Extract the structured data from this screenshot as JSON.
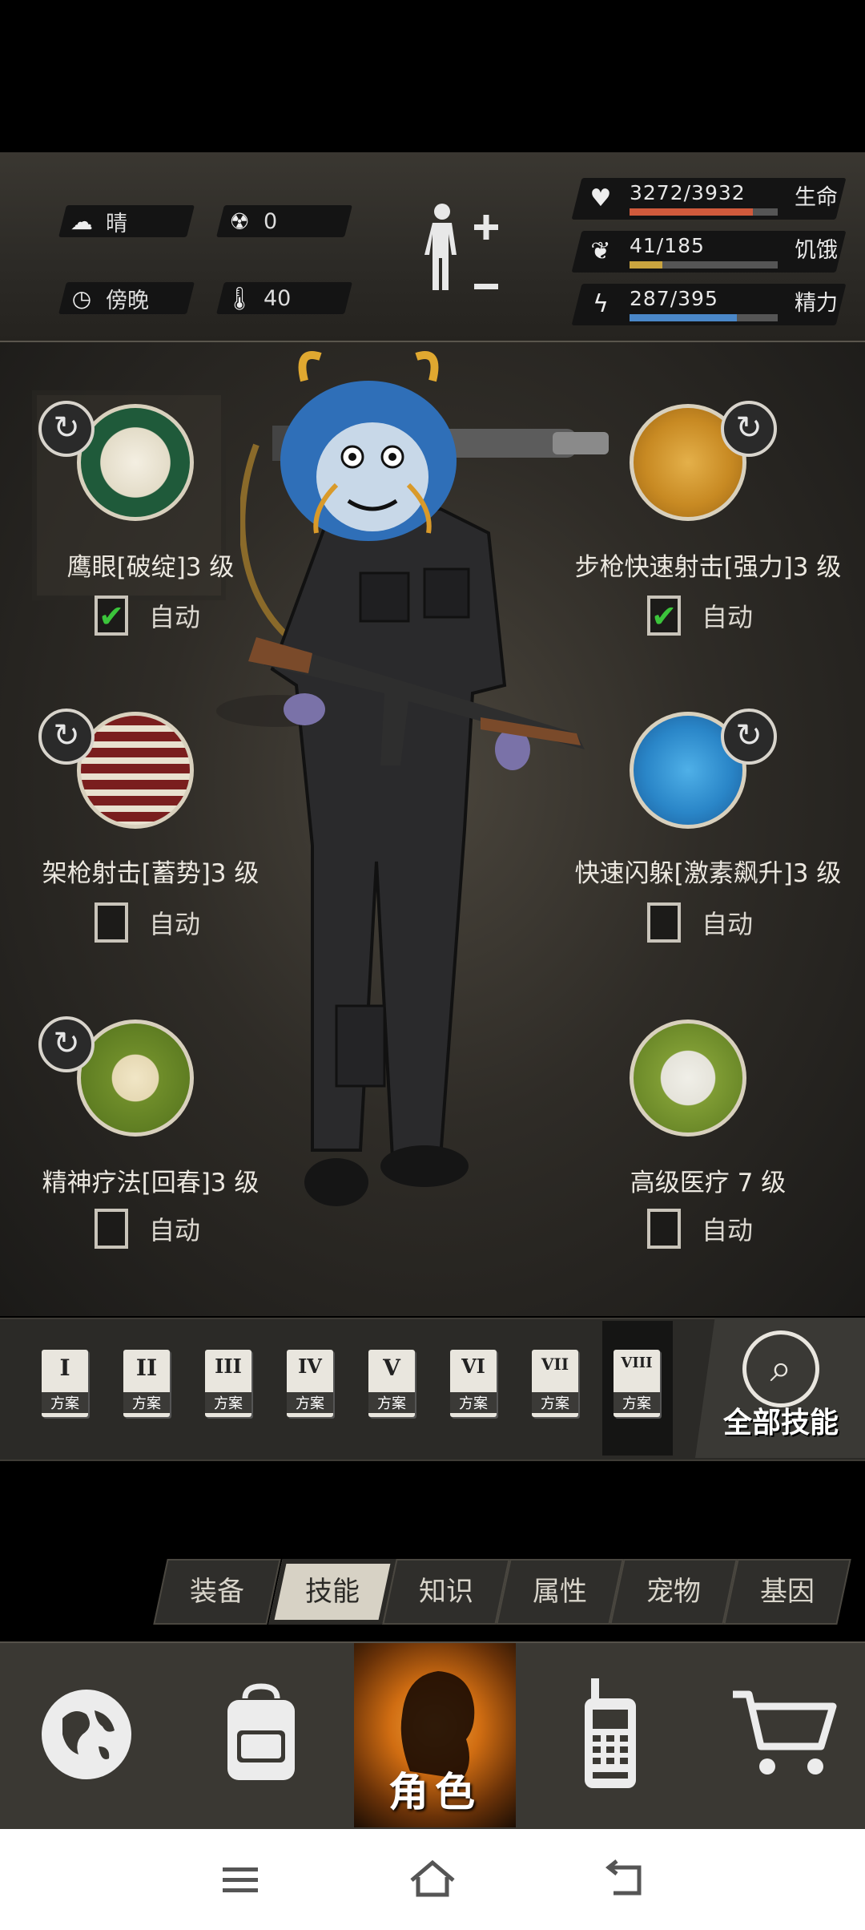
{
  "status": {
    "weather": {
      "icon": "cloud-sun-icon",
      "label": "晴"
    },
    "radiation": {
      "icon": "radiation-icon",
      "value": "0"
    },
    "time": {
      "icon": "clock-icon",
      "label": "傍晚"
    },
    "temperature": {
      "icon": "thermometer-icon",
      "value": "40"
    },
    "health": {
      "value": "3272/3932",
      "label": "生命",
      "fraction": 0.832,
      "color": "#d05a3c"
    },
    "hunger": {
      "value": "41/185",
      "label": "饥饿",
      "fraction": 0.222,
      "color": "#c9a43f"
    },
    "energy": {
      "value": "287/395",
      "label": "精力",
      "fraction": 0.727,
      "color": "#4a87c8"
    }
  },
  "skills": [
    {
      "name": "鹰眼[破绽]3 级",
      "auto_label": "自动",
      "auto": true,
      "icon": "eagle-icon"
    },
    {
      "name": "步枪快速射击[强力]3 级",
      "auto_label": "自动",
      "auto": true,
      "icon": "bullets-icon"
    },
    {
      "name": "架枪射击[蓄势]3 级",
      "auto_label": "自动",
      "auto": false,
      "icon": "prone-shooter-icon"
    },
    {
      "name": "快速闪躲[激素飙升]3 级",
      "auto_label": "自动",
      "auto": false,
      "icon": "dodge-icon"
    },
    {
      "name": "精神疗法[回春]3 级",
      "auto_label": "自动",
      "auto": false,
      "icon": "spirit-heal-icon"
    },
    {
      "name": "高级医疗 7 级",
      "auto_label": "自动",
      "auto": false,
      "icon": "medkit-icon"
    }
  ],
  "plans": [
    {
      "num": "I",
      "label": "方案"
    },
    {
      "num": "II",
      "label": "方案"
    },
    {
      "num": "III",
      "label": "方案"
    },
    {
      "num": "IV",
      "label": "方案"
    },
    {
      "num": "V",
      "label": "方案"
    },
    {
      "num": "VI",
      "label": "方案"
    },
    {
      "num": "VII",
      "label": "方案"
    },
    {
      "num": "VIII",
      "label": "方案"
    }
  ],
  "all_skills_label": "全部技能",
  "tabs": [
    {
      "label": "装备",
      "active": false
    },
    {
      "label": "技能",
      "active": true
    },
    {
      "label": "知识",
      "active": false
    },
    {
      "label": "属性",
      "active": false
    },
    {
      "label": "宠物",
      "active": false
    },
    {
      "label": "基因",
      "active": false
    }
  ],
  "nav": {
    "world": "globe-icon",
    "bag": "backpack-icon",
    "character": {
      "label": "角色",
      "icon": "character-head-icon"
    },
    "radio": "walkie-talkie-icon",
    "shop": "cart-icon"
  }
}
